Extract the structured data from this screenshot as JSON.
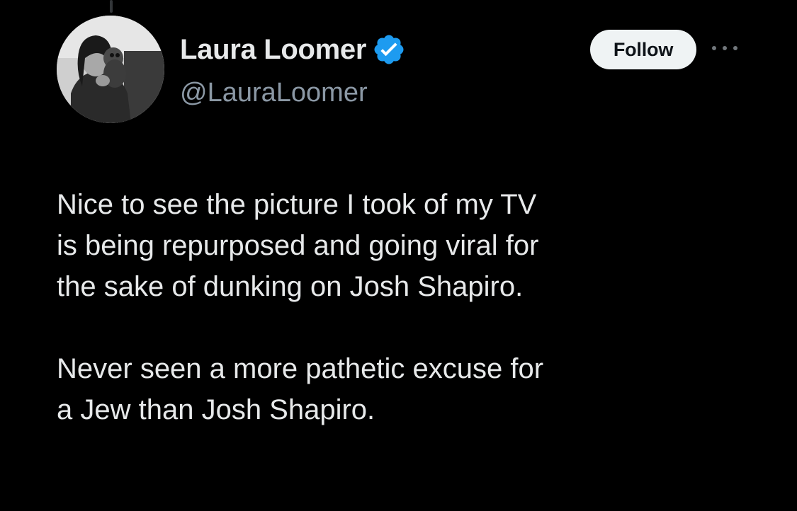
{
  "tweet": {
    "author": {
      "display_name": "Laura Loomer",
      "handle": "@LauraLoomer",
      "verified": true,
      "verified_color": "#1d9bf0",
      "avatar_icon": "profile-photo"
    },
    "follow_label": "Follow",
    "more_icon": "more-horizontal-icon",
    "paragraphs": [
      {
        "lines": [
          "Nice to see the picture I took of my TV",
          "is being repurposed and going viral for",
          "the sake of dunking on Josh Shapiro."
        ]
      },
      {
        "lines": [
          "Never seen a more pathetic excuse for",
          "a Jew than Josh Shapiro."
        ]
      }
    ]
  },
  "colors": {
    "background": "#000000",
    "text_primary": "#e7e9ea",
    "text_secondary": "#8b98a5",
    "button_bg": "#eff3f4",
    "button_text": "#0f1419"
  }
}
